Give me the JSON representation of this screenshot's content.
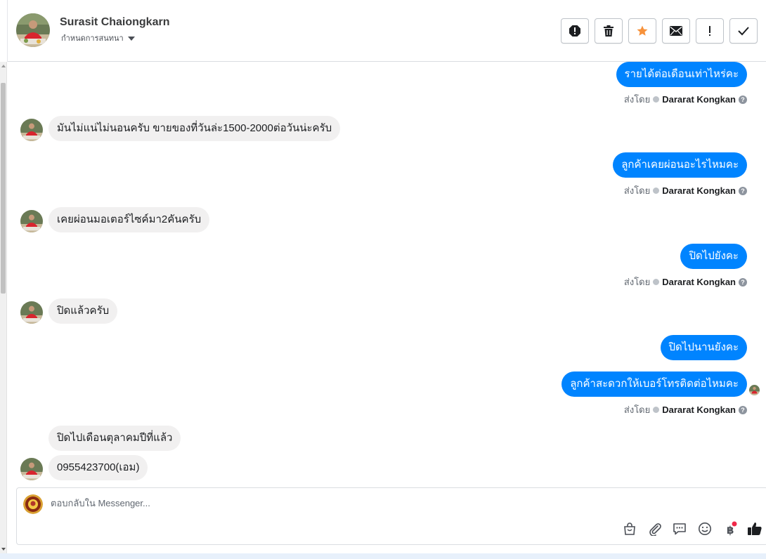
{
  "header": {
    "contact_name": "Surasit Chaiongkarn",
    "assign_label": "กำหนดการสนทนา",
    "actions": [
      {
        "name": "mark-spam-button",
        "icon": "alert-octagon-icon"
      },
      {
        "name": "delete-button",
        "icon": "trash-icon"
      },
      {
        "name": "star-button",
        "icon": "star-icon"
      },
      {
        "name": "mark-unread-button",
        "icon": "envelope-icon"
      },
      {
        "name": "follow-up-button",
        "icon": "exclamation-icon"
      },
      {
        "name": "mark-done-button",
        "icon": "checkmark-icon"
      }
    ],
    "star_color": "#f7923b"
  },
  "messages": {
    "m1": "รายได้ต่อเดือนเท่าไหร่คะ",
    "m2": "มันไม่แน่ไม่นอนครับ ขายของที่วันล่ะ1500-2000ต่อวันน่ะครับ",
    "m3": "ลูกค้าเคยผ่อนอะไรไหมคะ",
    "m4": "เคยผ่อนมอเตอร์ไซค์มา2คันครับ",
    "m5": "ปิดไปยังคะ",
    "m6": "ปิดแล้วครับ",
    "m7": "ปิดไปนานยังคะ",
    "m8": "ลูกค้าสะดวกให้เบอร์โทรติดต่อไหมคะ",
    "m9": "ปิดไปเดือนตุลาคมปีที่แล้ว",
    "m10": "0955423700(เอม)"
  },
  "sent_by": {
    "prefix": "ส่งโดย",
    "agent": "Dararat Kongkan",
    "help": "?"
  },
  "composer": {
    "placeholder": "ตอบกลับใน Messenger..."
  },
  "colors": {
    "outgoing_bubble": "#0084ff",
    "incoming_bubble": "#f1f0f0",
    "notification_dot": "#f02849"
  }
}
